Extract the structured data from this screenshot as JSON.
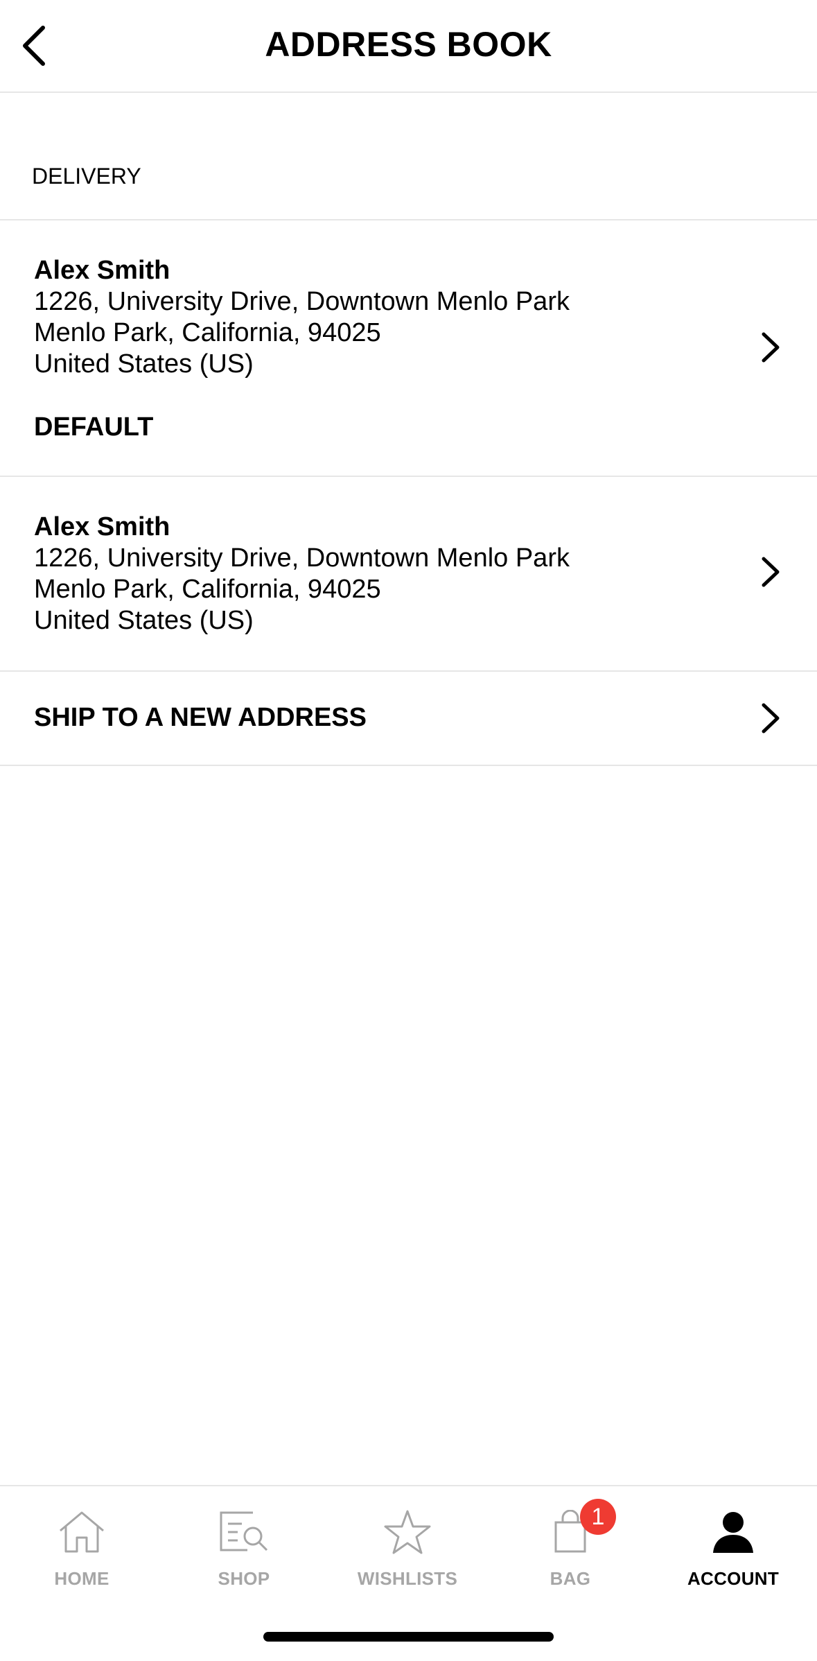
{
  "header": {
    "title": "ADDRESS BOOK",
    "back_icon": "chevron-left-icon"
  },
  "delivery": {
    "section_label": "DELIVERY",
    "addresses": [
      {
        "name": "Alex Smith",
        "line1": "1226, University Drive, Downtown Menlo Park",
        "line2": "Menlo Park, California, 94025",
        "line3": "United States (US)",
        "default_label": "DEFAULT"
      },
      {
        "name": "Alex Smith",
        "line1": "1226, University Drive, Downtown Menlo Park",
        "line2": "Menlo Park, California, 94025",
        "line3": "United States (US)"
      }
    ],
    "new_address_label": "SHIP TO A NEW ADDRESS"
  },
  "tabbar": {
    "tabs": [
      {
        "label": "HOME",
        "icon": "home-icon",
        "active": false
      },
      {
        "label": "SHOP",
        "icon": "shop-search-icon",
        "active": false
      },
      {
        "label": "WISHLISTS",
        "icon": "star-icon",
        "active": false
      },
      {
        "label": "BAG",
        "icon": "bag-icon",
        "active": false,
        "badge": "1"
      },
      {
        "label": "ACCOUNT",
        "icon": "person-icon",
        "active": true
      }
    ]
  },
  "colors": {
    "badge": "#ef3b32",
    "inactive_tab": "#a6a6a6",
    "divider": "#e6e6e6"
  }
}
